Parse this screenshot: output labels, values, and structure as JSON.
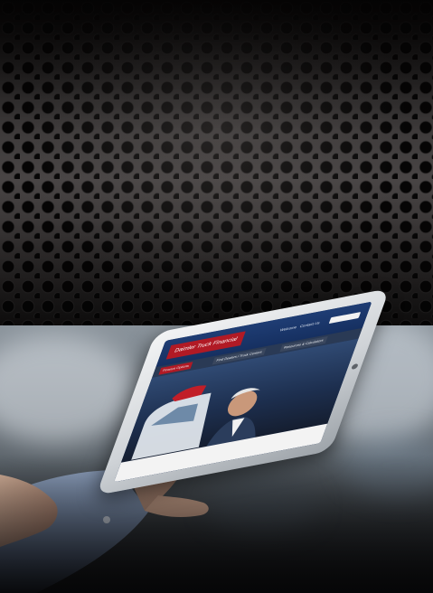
{
  "scene": {
    "top": "perforated metal grille panel",
    "bottom": "hand holding a tablet showing a website"
  },
  "tablet_screen": {
    "logo_text": "Daimler Truck Financial",
    "nav": [
      "Welcome",
      "Contact Us"
    ],
    "tabs": [
      "Finance Options",
      "Find Dealers / Truck Centers",
      "Resources & Calculators"
    ],
    "hero_text": "",
    "bottom_text": ""
  },
  "colors": {
    "brand_red": "#b11a25",
    "brand_navy": "#1f3d74",
    "metal_dark": "#0b0a0a"
  }
}
